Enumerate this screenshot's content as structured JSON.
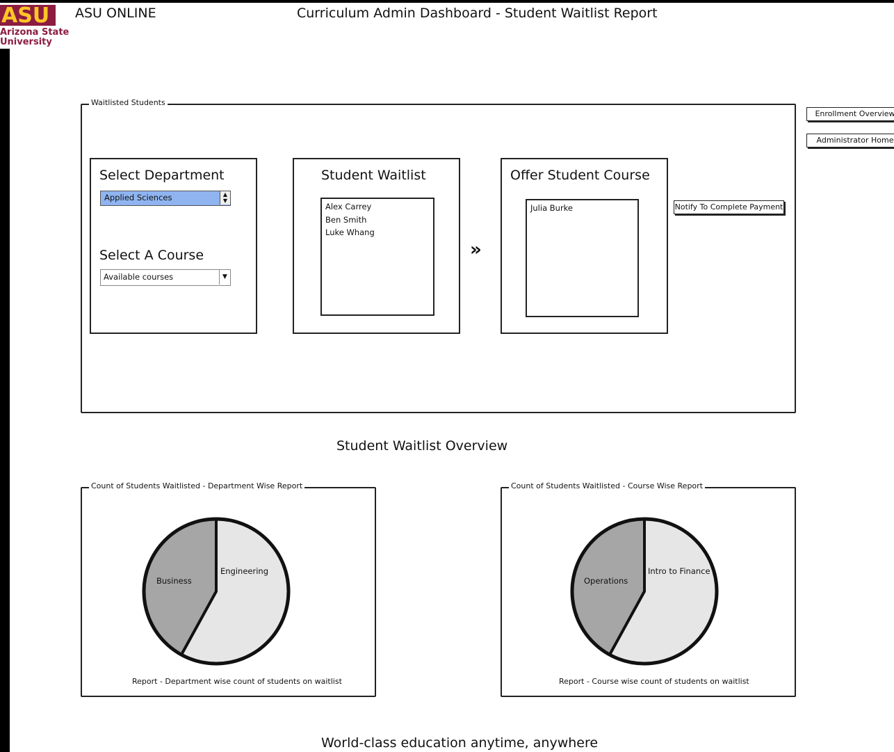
{
  "header": {
    "logo_mark": "ASU",
    "logo_text_line1": "Arizona State",
    "logo_text_line2": "University",
    "app_name": "ASU ONLINE",
    "page_title": "Curriculum Admin Dashboard - Student Waitlist Report"
  },
  "nav": {
    "enrollment_overview": "Enrollment Overview",
    "administrator_home": "Administrator Home"
  },
  "waitlist_group": {
    "legend": "Waitlisted Students",
    "select_department": {
      "heading": "Select Department",
      "selected": "Applied Sciences"
    },
    "select_course": {
      "heading": "Select A Course",
      "selected": "Available courses"
    },
    "student_waitlist": {
      "heading": "Student Waitlist",
      "students": [
        "Alex Carrey",
        "Ben Smith",
        "Luke Whang"
      ]
    },
    "move_button": "»",
    "offer_course": {
      "heading": "Offer Student Course",
      "students": [
        "Julia Burke"
      ]
    },
    "notify_button": "Notify To Complete Payment"
  },
  "overview_title": "Student Waitlist Overview",
  "charts": {
    "department": {
      "legend": "Count of Students Waitlisted - Department Wise Report",
      "caption": "Report - Department wise count of students on waitlist",
      "slices": [
        {
          "label": "Engineering",
          "fraction": 0.58,
          "color": "#e6e6e6"
        },
        {
          "label": "Business",
          "fraction": 0.42,
          "color": "#a6a6a6"
        }
      ]
    },
    "course": {
      "legend": "Count of Students Waitlisted - Course Wise Report",
      "caption": "Report - Course wise count of students on waitlist",
      "slices": [
        {
          "label": "Intro to Finance",
          "fraction": 0.58,
          "color": "#e6e6e6"
        },
        {
          "label": "Operations",
          "fraction": 0.42,
          "color": "#a6a6a6"
        }
      ]
    }
  },
  "chart_data": [
    {
      "type": "pie",
      "title": "Count of Students Waitlisted - Department Wise Report",
      "categories": [
        "Engineering",
        "Business"
      ],
      "values": [
        0.58,
        0.42
      ]
    },
    {
      "type": "pie",
      "title": "Count of Students Waitlisted - Course Wise Report",
      "categories": [
        "Intro to Finance",
        "Operations"
      ],
      "values": [
        0.58,
        0.42
      ]
    }
  ],
  "footer": {
    "tagline": "World-class education anytime, anywhere"
  },
  "colors": {
    "asu_maroon": "#8c1d40",
    "selected_blue": "#8fb4f0",
    "slice_light": "#e6e6e6",
    "slice_dark": "#a6a6a6"
  }
}
